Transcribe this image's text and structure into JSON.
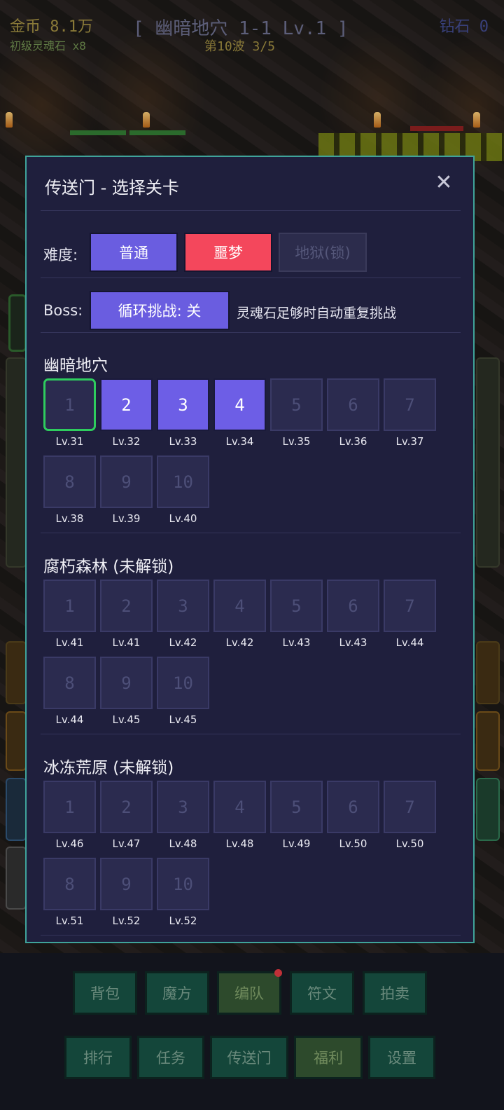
{
  "hud": {
    "gold": "金币 8.1万",
    "soul_stone": "初级灵魂石 x8",
    "stage_title": "[ 幽暗地穴 1-1 Lv.1 ]",
    "wave": "第10波 3/5",
    "diamond": "钻石 0"
  },
  "modal": {
    "title": "传送门 - 选择关卡",
    "close_icon": "close-icon",
    "difficulty": {
      "label": "难度:",
      "options": [
        {
          "label": "普通",
          "state": "available"
        },
        {
          "label": "噩梦",
          "state": "selected"
        },
        {
          "label": "地狱(锁)",
          "state": "locked"
        }
      ]
    },
    "boss": {
      "label": "Boss:",
      "button": "循环挑战: 关",
      "hint": "灵魂石足够时自动重复挑战"
    },
    "zones": [
      {
        "name": "幽暗地穴",
        "levels": [
          {
            "num": "1",
            "lv": "Lv.31",
            "state": "current"
          },
          {
            "num": "2",
            "lv": "Lv.32",
            "state": "open"
          },
          {
            "num": "3",
            "lv": "Lv.33",
            "state": "open"
          },
          {
            "num": "4",
            "lv": "Lv.34",
            "state": "open"
          },
          {
            "num": "5",
            "lv": "Lv.35",
            "state": "locked"
          },
          {
            "num": "6",
            "lv": "Lv.36",
            "state": "locked"
          },
          {
            "num": "7",
            "lv": "Lv.37",
            "state": "locked"
          },
          {
            "num": "8",
            "lv": "Lv.38",
            "state": "locked"
          },
          {
            "num": "9",
            "lv": "Lv.39",
            "state": "locked"
          },
          {
            "num": "10",
            "lv": "Lv.40",
            "state": "locked"
          }
        ]
      },
      {
        "name": "腐朽森林 (未解锁)",
        "levels": [
          {
            "num": "1",
            "lv": "Lv.41",
            "state": "locked"
          },
          {
            "num": "2",
            "lv": "Lv.41",
            "state": "locked"
          },
          {
            "num": "3",
            "lv": "Lv.42",
            "state": "locked"
          },
          {
            "num": "4",
            "lv": "Lv.42",
            "state": "locked"
          },
          {
            "num": "5",
            "lv": "Lv.43",
            "state": "locked"
          },
          {
            "num": "6",
            "lv": "Lv.43",
            "state": "locked"
          },
          {
            "num": "7",
            "lv": "Lv.44",
            "state": "locked"
          },
          {
            "num": "8",
            "lv": "Lv.44",
            "state": "locked"
          },
          {
            "num": "9",
            "lv": "Lv.45",
            "state": "locked"
          },
          {
            "num": "10",
            "lv": "Lv.45",
            "state": "locked"
          }
        ]
      },
      {
        "name": "冰冻荒原 (未解锁)",
        "levels": [
          {
            "num": "1",
            "lv": "Lv.46",
            "state": "locked"
          },
          {
            "num": "2",
            "lv": "Lv.47",
            "state": "locked"
          },
          {
            "num": "3",
            "lv": "Lv.48",
            "state": "locked"
          },
          {
            "num": "4",
            "lv": "Lv.48",
            "state": "locked"
          },
          {
            "num": "5",
            "lv": "Lv.49",
            "state": "locked"
          },
          {
            "num": "6",
            "lv": "Lv.50",
            "state": "locked"
          },
          {
            "num": "7",
            "lv": "Lv.50",
            "state": "locked"
          },
          {
            "num": "8",
            "lv": "Lv.51",
            "state": "locked"
          },
          {
            "num": "9",
            "lv": "Lv.52",
            "state": "locked"
          },
          {
            "num": "10",
            "lv": "Lv.52",
            "state": "locked"
          }
        ]
      }
    ]
  },
  "bottom_nav": {
    "row1": [
      "背包",
      "魔方",
      "编队",
      "符文",
      "拍卖"
    ],
    "row2": [
      "排行",
      "任务",
      "传送门",
      "福利",
      "设置"
    ]
  },
  "colors": {
    "modal_bg": "#1f1f3d",
    "modal_border": "#3fa39a",
    "accent_purple": "#6a5de0",
    "nightmare_red": "#f4475c",
    "current_green": "#2ecc5e"
  }
}
